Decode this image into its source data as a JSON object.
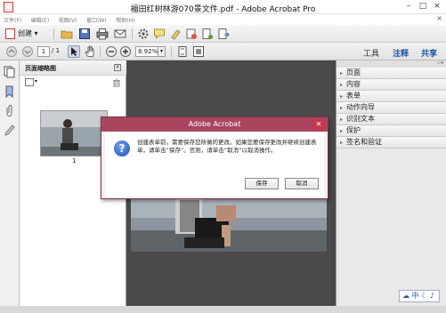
{
  "window": {
    "title": "福田红树林游070景文件.pdf - Adobe Acrobat Pro",
    "minimize": "–",
    "maximize": "□",
    "close": "×"
  },
  "menubar": {
    "items": [
      "文件(F)",
      "编辑(E)",
      "视图(V)",
      "窗口(W)",
      "帮助(H)"
    ],
    "close_doc": "×"
  },
  "toolbar": {
    "create_label": "创建",
    "create_arrow": "▾"
  },
  "navbar": {
    "page_current": "1",
    "page_total": "/ 1",
    "zoom": "8.92%",
    "zoom_arrow": "▾",
    "tabs": [
      "工具",
      "注释",
      "共享"
    ]
  },
  "thumb_panel": {
    "title": "页面缩略图",
    "close": "×",
    "options_arrow": "▾",
    "page_number": "1"
  },
  "right_panel": {
    "items": [
      "页面",
      "内容",
      "表单",
      "动作向导",
      "识别文本",
      "保护",
      "签名和验证"
    ]
  },
  "dialog": {
    "title": "Adobe Acrobat",
    "close": "✕",
    "icon": "?",
    "message": "创建表单前，需要保存您所做的更改。如果您要保存更改并继续创建表单，请单击“保存”。否则，请单击“取消”以取消操作。",
    "save_label": "保存",
    "cancel_label": "取消"
  },
  "ime": {
    "label": "中",
    "extra": "☾ ♪"
  },
  "colors": {
    "dialog_title": "#a8455f",
    "doc_background": "#4a4a4a",
    "active_tab": "#1a56a8"
  }
}
